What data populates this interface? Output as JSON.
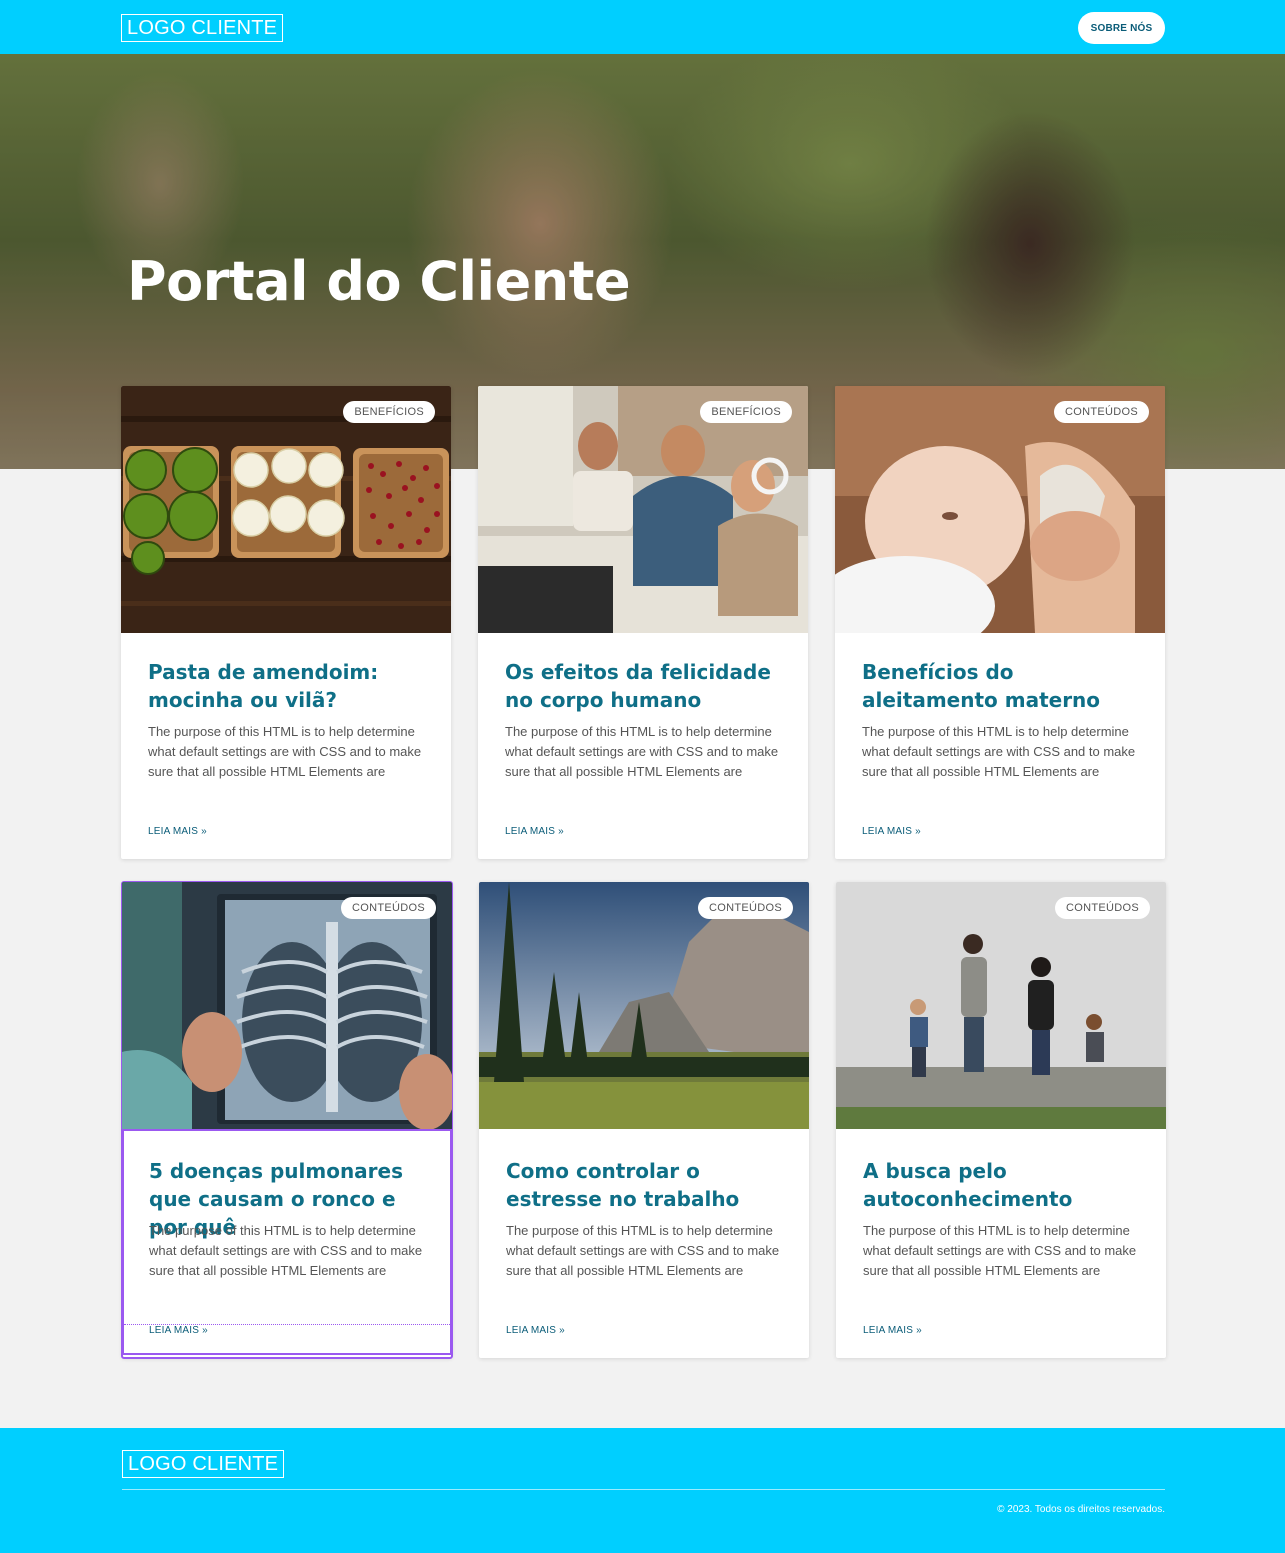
{
  "header": {
    "logo": "LOGO CLIENTE",
    "about_button": "SOBRE NÓS"
  },
  "hero": {
    "title": "Portal do Cliente"
  },
  "colors": {
    "brand": "#00cfff",
    "title": "#0f6f87",
    "link": "#0a5c78"
  },
  "cards": [
    {
      "badge": "BENEFÍCIOS",
      "title": "Pasta de amendoim: mocinha ou vilã?",
      "text": "The purpose of this HTML is to help determine what default settings are with CSS and to make sure that all possible HTML Elements are",
      "link": "LEIA MAIS »"
    },
    {
      "badge": "BENEFÍCIOS",
      "title": "Os efeitos da felicidade no corpo humano",
      "text": "The purpose of this HTML is to help determine what default settings are with CSS and to make sure that all possible HTML Elements are",
      "link": "LEIA MAIS »"
    },
    {
      "badge": "CONTEÚDOS",
      "title": "Benefícios do aleitamento materno",
      "text": "The purpose of this HTML is to help determine what default settings are with CSS and to make sure that all possible HTML Elements are",
      "link": "LEIA MAIS »"
    },
    {
      "badge": "CONTEÚDOS",
      "title": "5 doenças pulmonares que causam o ronco e por quê",
      "text": "The purpose of this HTML is to help determine what default settings are with CSS and to make sure that all possible HTML Elements are",
      "link": "LEIA MAIS »"
    },
    {
      "badge": "CONTEÚDOS",
      "title": "Como controlar o estresse no trabalho",
      "text": "The purpose of this HTML is to help determine what default settings are with CSS and to make sure that all possible HTML Elements are",
      "link": "LEIA MAIS »"
    },
    {
      "badge": "CONTEÚDOS",
      "title": "A busca pelo autoconhecimento",
      "text": "The purpose of this HTML is to help determine what default settings are with CSS and to make sure that all possible HTML Elements are",
      "link": "LEIA MAIS »"
    }
  ],
  "footer": {
    "logo": "LOGO CLIENTE",
    "copyright": "© 2023. Todos os direitos reservados."
  }
}
